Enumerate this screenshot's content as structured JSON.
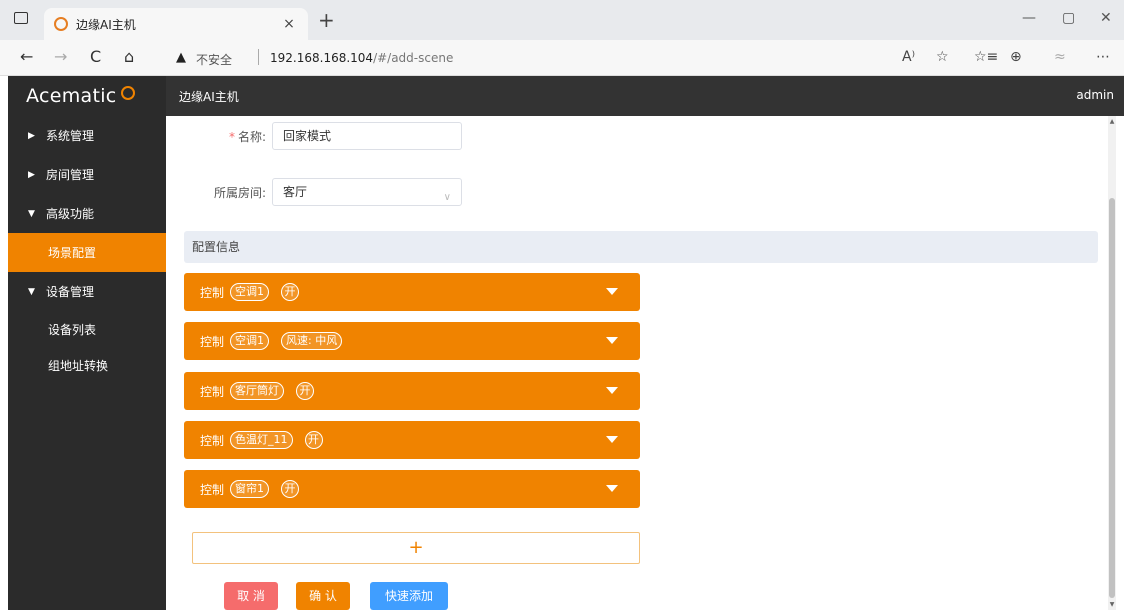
{
  "browser": {
    "tab_title": "边缘AI主机",
    "tab_close": "×",
    "new_tab": "+",
    "win_min": "—",
    "win_max": "▢",
    "win_close": "✕",
    "back": "←",
    "forward": "→",
    "reload": "C",
    "home": "⌂",
    "warning_icon": "▲",
    "insecure_label": "不安全",
    "url_host": "192.168.168.104",
    "url_path": "/#/add-scene",
    "toolbar_icons": [
      "A⁾",
      "☆",
      "☆≡",
      "⊕",
      "≈",
      "⋯"
    ]
  },
  "header": {
    "logo": "Acematic",
    "title": "边缘AI主机",
    "user": "admin"
  },
  "sidebar": {
    "items": [
      {
        "label": "系统管理",
        "arrow": "▶"
      },
      {
        "label": "房间管理",
        "arrow": "▶"
      },
      {
        "label": "高级功能",
        "arrow": "▼"
      },
      {
        "label": "场景配置"
      },
      {
        "label": "设备管理",
        "arrow": "▼"
      },
      {
        "label": "设备列表"
      },
      {
        "label": "组地址转换"
      }
    ]
  },
  "form": {
    "required_mark": "*",
    "name_label": "名称:",
    "name_value": "回家模式",
    "room_label": "所属房间:",
    "room_value": "客厅",
    "select_arrow": "∨"
  },
  "config": {
    "section_title": "配置信息",
    "rows": [
      {
        "word": "控制",
        "device": "空调1",
        "value": "开"
      },
      {
        "word": "控制",
        "device": "空调1",
        "value": "风速: 中风"
      },
      {
        "word": "控制",
        "device": "客厅筒灯",
        "value": "开"
      },
      {
        "word": "控制",
        "device": "色温灯_11",
        "value": "开"
      },
      {
        "word": "控制",
        "device": "窗帘1",
        "value": "开"
      }
    ],
    "add_symbol": "+"
  },
  "buttons": {
    "cancel": "取 消",
    "confirm": "确 认",
    "quick_add": "快速添加"
  },
  "colors": {
    "accent": "#f08300",
    "cancel": "#f56c6c",
    "quick_add": "#409eff",
    "sidebar": "#2b2b2b",
    "header": "#333333"
  }
}
